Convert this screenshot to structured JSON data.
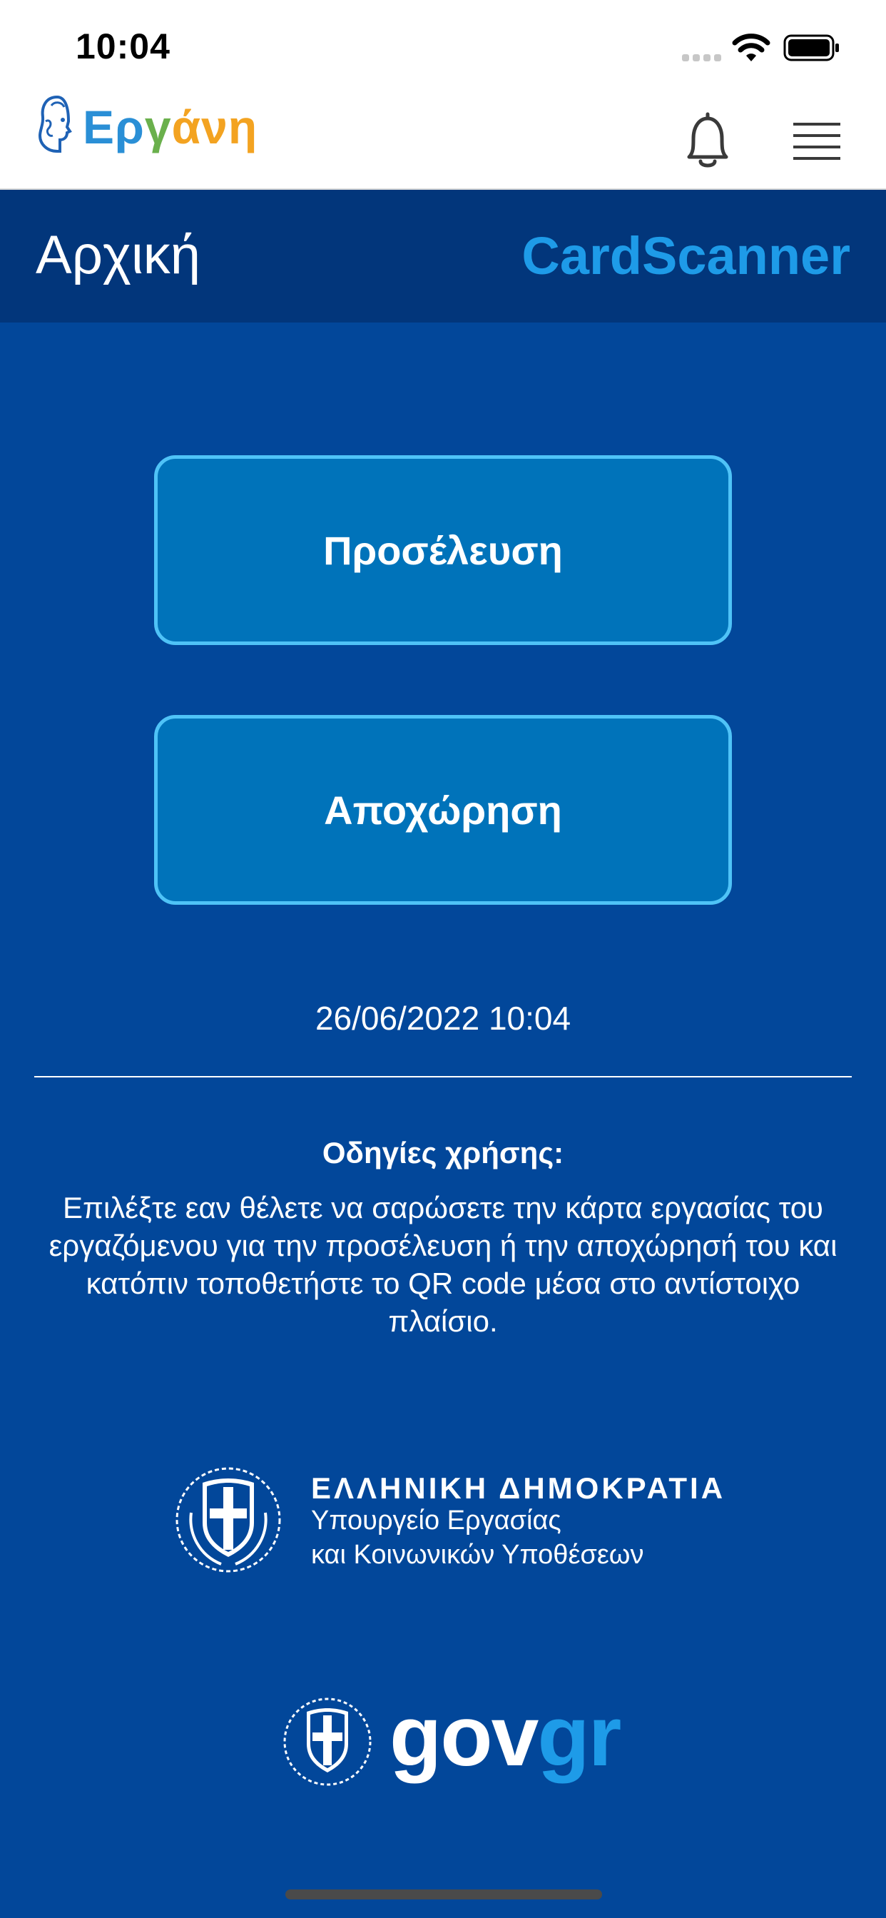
{
  "status_bar": {
    "time": "10:04"
  },
  "header": {
    "logo": {
      "part1": "Ερ",
      "part2": "γ",
      "part3": "άνη"
    }
  },
  "title_bar": {
    "page_title": "Αρχική",
    "brand": "CardScanner"
  },
  "actions": {
    "arrival_label": "Προσέλευση",
    "departure_label": "Αποχώρηση"
  },
  "datetime": "26/06/2022 10:04",
  "instructions": {
    "title": "Οδηγίες χρήσης:",
    "body": "Επιλέξτε εαν θέλετε να σαρώσετε την κάρτα εργασίας του εργαζόμενου για την προσέλευση ή την αποχώρησή του και κατόπιν τοποθετήστε το QR code μέσα στο αντίστοιχο πλαίσιο."
  },
  "ministry": {
    "country": "ΕΛΛΗΝΙΚΗ ΔΗΜΟΚΡΑΤΙΑ",
    "line1": "Υπουργείο Εργασίας",
    "line2": "και Κοινωνικών Υποθέσεων"
  },
  "gov": {
    "part1": "gov",
    "part2": "gr"
  },
  "colors": {
    "background": "#02479a",
    "title_bar": "#02367b",
    "button_fill": "#0073ba",
    "button_border": "#4fc3f7",
    "accent": "#1e9be8"
  },
  "icons": [
    "signal-icon",
    "wifi-icon",
    "battery-icon",
    "ergani-logo-icon",
    "bell-icon",
    "menu-icon",
    "greek-emblem-icon"
  ]
}
